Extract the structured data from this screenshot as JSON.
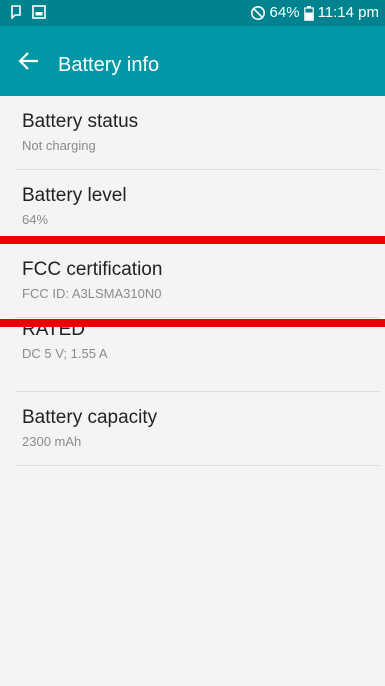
{
  "status_bar": {
    "left_icons": [
      "notification-icon",
      "image-icon"
    ],
    "right_icons": [
      "do-not-disturb-icon",
      "battery-icon"
    ],
    "battery_percent": "64%",
    "time": "11:14 pm",
    "bar_color": "#00838f"
  },
  "app_bar": {
    "title": "Battery info",
    "back_icon": "arrow-left-icon",
    "bar_color": "#0097a7"
  },
  "items": [
    {
      "title": "Battery status",
      "subtitle": "Not charging"
    },
    {
      "title": "Battery level",
      "subtitle": "64%"
    },
    {
      "title": "FCC certification",
      "subtitle": "FCC ID: A3LSMA310N0"
    },
    {
      "title": "RATED",
      "subtitle": "DC 5 V; 1.55 A"
    },
    {
      "title": "Battery capacity",
      "subtitle": "2300 mAh"
    }
  ],
  "highlight_color": "#ee0000"
}
